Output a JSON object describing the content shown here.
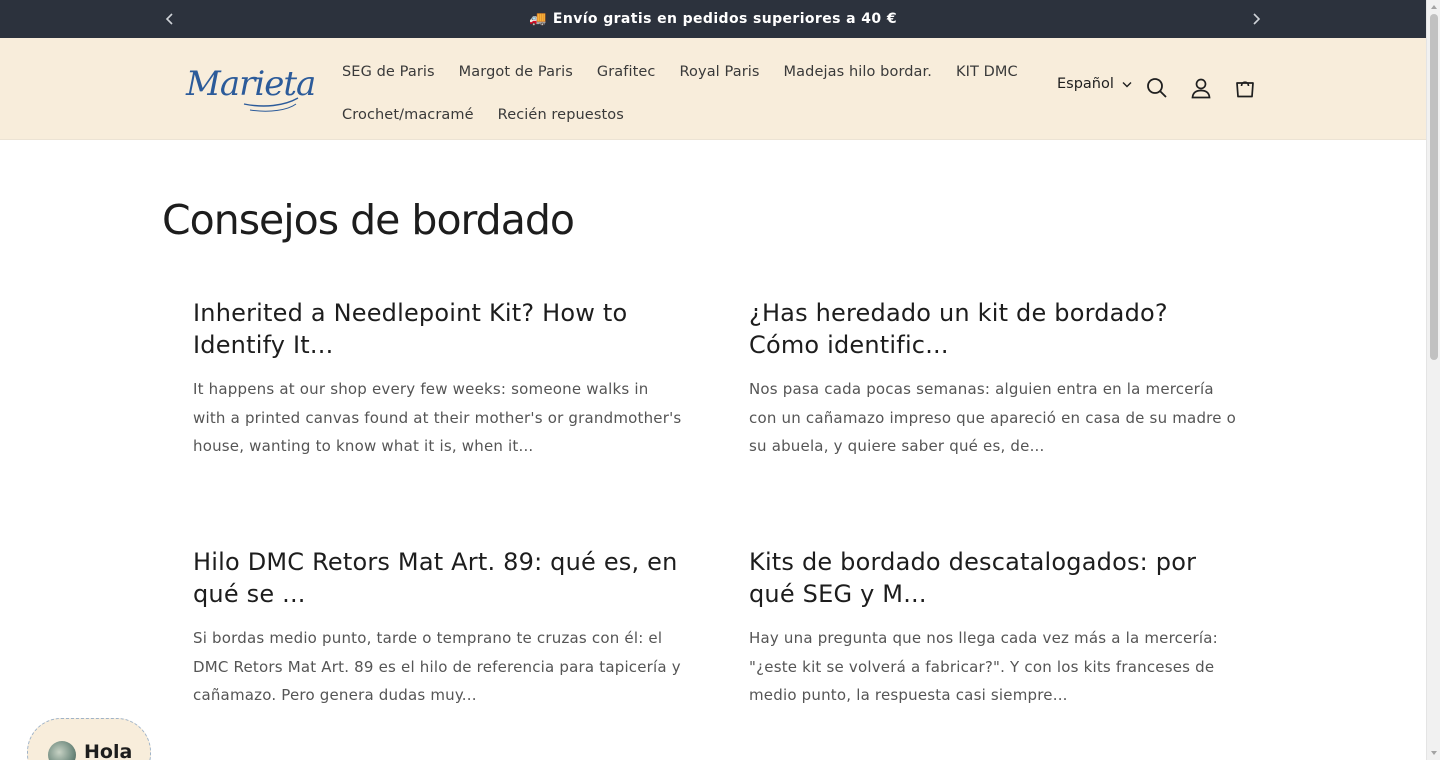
{
  "announcement": {
    "emoji": "🚚",
    "text": "Envío gratis en pedidos superiores a 40 €"
  },
  "header": {
    "logo_text": "Marieta",
    "nav_row1": [
      "SEG de Paris",
      "Margot de Paris",
      "Grafitec",
      "Royal Paris",
      "Madejas hilo bordar.",
      "KIT DMC"
    ],
    "nav_row2": [
      "Crochet/macramé",
      "Recién repuestos"
    ],
    "language": "Español",
    "icons": [
      "search-icon",
      "account-icon",
      "cart-icon"
    ]
  },
  "main": {
    "page_title": "Consejos de bordado",
    "articles": [
      {
        "title": "Inherited a Needlepoint Kit? How to Identify It...",
        "excerpt": "It happens at our shop every few weeks: someone walks in with a printed canvas found at their mother's or grandmother's house, wanting to know what it is, when it..."
      },
      {
        "title": "¿Has heredado un kit de bordado? Cómo identific...",
        "excerpt": "Nos pasa cada pocas semanas: alguien entra en la mercería con un cañamazo impreso que apareció en casa de su madre o su abuela, y quiere saber qué es, de..."
      },
      {
        "title": "Hilo DMC Retors Mat Art. 89: qué es, en qué se ...",
        "excerpt": "Si bordas medio punto, tarde o temprano te cruzas con él: el DMC Retors Mat Art. 89 es el hilo de referencia para tapicería y cañamazo. Pero genera dudas muy..."
      },
      {
        "title": "Kits de bordado descatalogados: por qué SEG y M...",
        "excerpt": "Hay una pregunta que nos llega cada vez más a la mercería: \"¿este kit se volverá a fabricar?\". Y con los kits franceses de medio punto, la respuesta casi siempre..."
      }
    ]
  },
  "chat": {
    "label": "Hola"
  },
  "colors": {
    "announcement_bg": "#2c323d",
    "header_bg": "#f8eddb",
    "logo": "#2c5b9a"
  }
}
